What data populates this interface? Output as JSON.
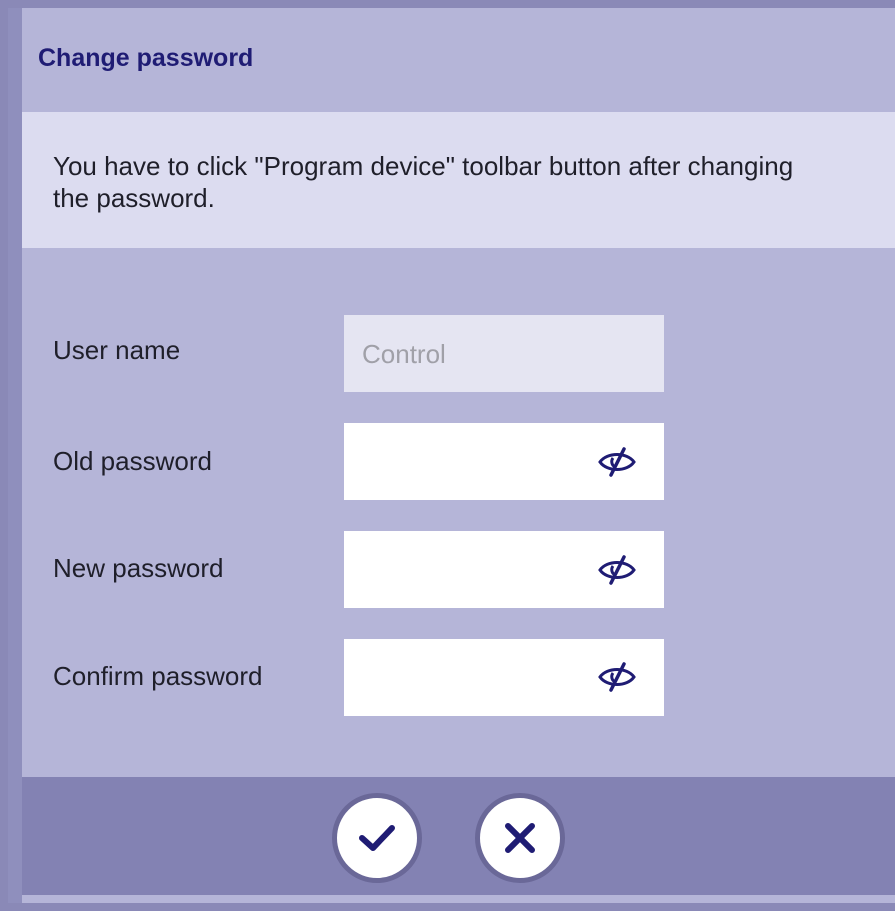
{
  "dialog": {
    "title": "Change password",
    "notice": "You have to click \"Program device\" toolbar button after changing the password."
  },
  "form": {
    "user_name": {
      "label": "User name",
      "value": "Control"
    },
    "old_password": {
      "label": "Old password",
      "value": "",
      "toggle_icon": "eye-slash-icon"
    },
    "new_password": {
      "label": "New password",
      "value": "",
      "toggle_icon": "eye-slash-icon"
    },
    "confirm_password": {
      "label": "Confirm password",
      "value": "",
      "toggle_icon": "eye-slash-icon"
    }
  },
  "footer": {
    "confirm_icon": "checkmark-icon",
    "cancel_icon": "close-icon"
  },
  "colors": {
    "title_text": "#1f1c74",
    "dialog_background": "#b5b5d8",
    "notice_background": "#dcdcf0",
    "footer_background": "#8382b3",
    "button_icon": "#1f1c74"
  }
}
